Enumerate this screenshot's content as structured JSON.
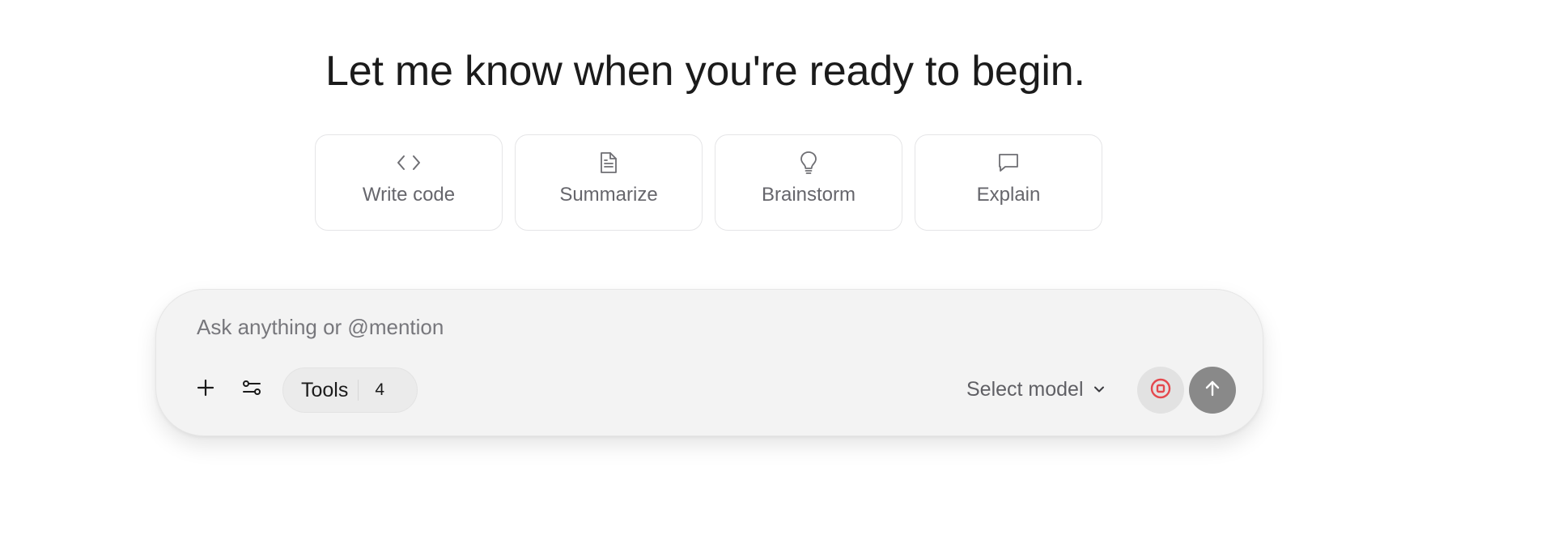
{
  "heading": "Let me know when you're ready to begin.",
  "suggestions": [
    {
      "label": "Write code",
      "icon": "code-icon"
    },
    {
      "label": "Summarize",
      "icon": "document-icon"
    },
    {
      "label": "Brainstorm",
      "icon": "lightbulb-icon"
    },
    {
      "label": "Explain",
      "icon": "chat-bubble-icon"
    }
  ],
  "composer": {
    "placeholder": "Ask anything or @mention",
    "value": "",
    "add_icon": "plus-icon",
    "settings_icon": "sliders-icon",
    "tools_label": "Tools",
    "tools_count": "4",
    "model_label": "Select model",
    "model_icon": "chevron-down-icon",
    "stop_icon": "stop-icon",
    "send_icon": "arrow-up-icon"
  },
  "colors": {
    "stop_accent": "#e5484d",
    "send_button": "#898989",
    "composer_bg": "#f3f3f3"
  }
}
